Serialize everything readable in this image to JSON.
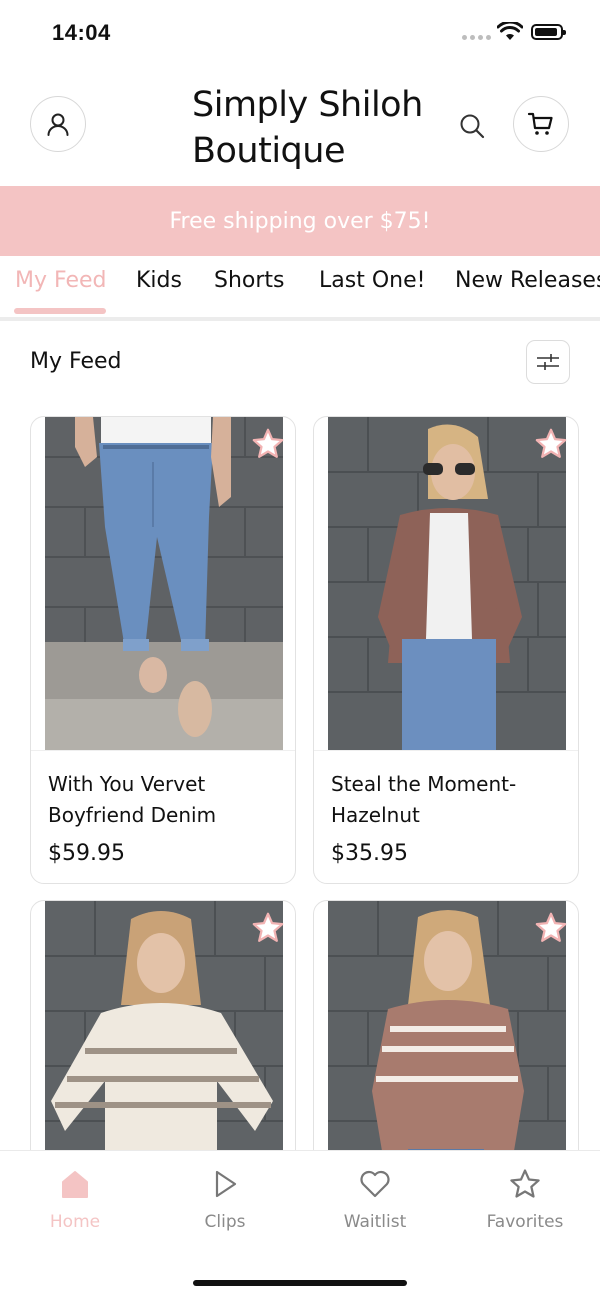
{
  "status_bar": {
    "time": "14:04"
  },
  "header": {
    "title_line1": "Simply Shiloh",
    "title_line2": "Boutique"
  },
  "banner": {
    "text": "Free shipping over $75!"
  },
  "tabs": [
    {
      "label": "My Feed",
      "active": true
    },
    {
      "label": "Kids"
    },
    {
      "label": "Shorts"
    },
    {
      "label": "Last One!"
    },
    {
      "label": "New Releases"
    }
  ],
  "feed": {
    "title": "My Feed"
  },
  "products": [
    {
      "name": "With You Vervet Boyfriend Denim",
      "price": "$59.95"
    },
    {
      "name": "Steal the Moment-Hazelnut",
      "price": "$35.95"
    },
    {
      "name": "",
      "price": ""
    },
    {
      "name": "",
      "price": ""
    }
  ],
  "bottom_nav": [
    {
      "label": "Home",
      "icon": "home-icon",
      "active": true
    },
    {
      "label": "Clips",
      "icon": "play-icon"
    },
    {
      "label": "Waitlist",
      "icon": "heart-icon"
    },
    {
      "label": "Favorites",
      "icon": "star-icon"
    }
  ],
  "colors": {
    "accent_pink": "#f4c4c4",
    "tab_active": "#f2b6b6",
    "text": "#111111",
    "muted": "#8a8a8a"
  }
}
